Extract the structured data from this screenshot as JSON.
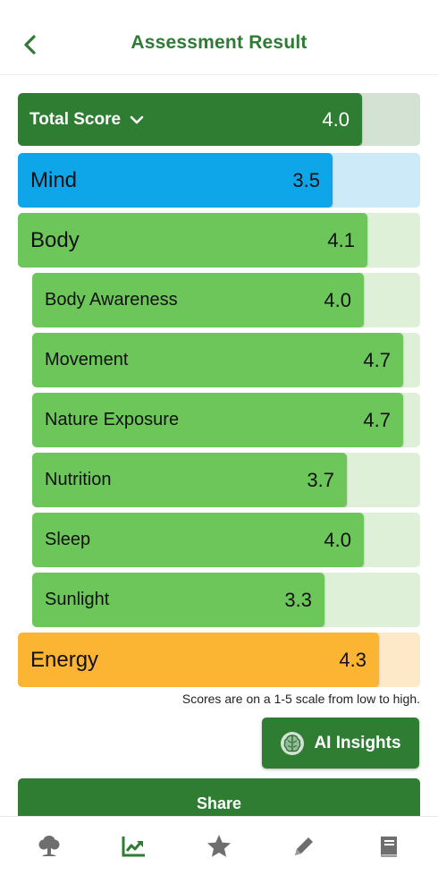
{
  "header": {
    "title": "Assessment Result",
    "back_icon": "chevron-left-icon"
  },
  "colors": {
    "dark_green": "#2e7d32",
    "green": "#6cc65a",
    "green_track": "#def0d7",
    "blue": "#0ea5e9",
    "blue_track": "#cdeaf8",
    "orange": "#fbb533",
    "orange_track": "#fde9c8",
    "total_track": "#d4e2d4"
  },
  "scale": {
    "min": 1,
    "max": 5
  },
  "results": [
    {
      "label": "Total Score",
      "value": "4.0",
      "level": "total",
      "expanded": true
    },
    {
      "label": "Mind",
      "value": "3.5",
      "level": "category",
      "color": "blue"
    },
    {
      "label": "Body",
      "value": "4.1",
      "level": "category",
      "color": "green"
    },
    {
      "label": "Body Awareness",
      "value": "4.0",
      "level": "subcategory"
    },
    {
      "label": "Movement",
      "value": "4.7",
      "level": "subcategory"
    },
    {
      "label": "Nature Exposure",
      "value": "4.7",
      "level": "subcategory"
    },
    {
      "label": "Nutrition",
      "value": "3.7",
      "level": "subcategory"
    },
    {
      "label": "Sleep",
      "value": "4.0",
      "level": "subcategory"
    },
    {
      "label": "Sunlight",
      "value": "3.3",
      "level": "subcategory"
    },
    {
      "label": "Energy",
      "value": "4.3",
      "level": "category",
      "color": "orange"
    }
  ],
  "note": "Scores are on a 1-5 scale from low to high.",
  "ai_button": {
    "label": "AI Insights",
    "icon": "brain-icon"
  },
  "bottom_button": {
    "label": "Share"
  },
  "bottom_nav": [
    {
      "icon": "tree-icon",
      "active": false
    },
    {
      "icon": "trend-chart-icon",
      "active": true
    },
    {
      "icon": "star-icon",
      "active": false
    },
    {
      "icon": "pencil-icon",
      "active": false
    },
    {
      "icon": "book-icon",
      "active": false
    }
  ]
}
